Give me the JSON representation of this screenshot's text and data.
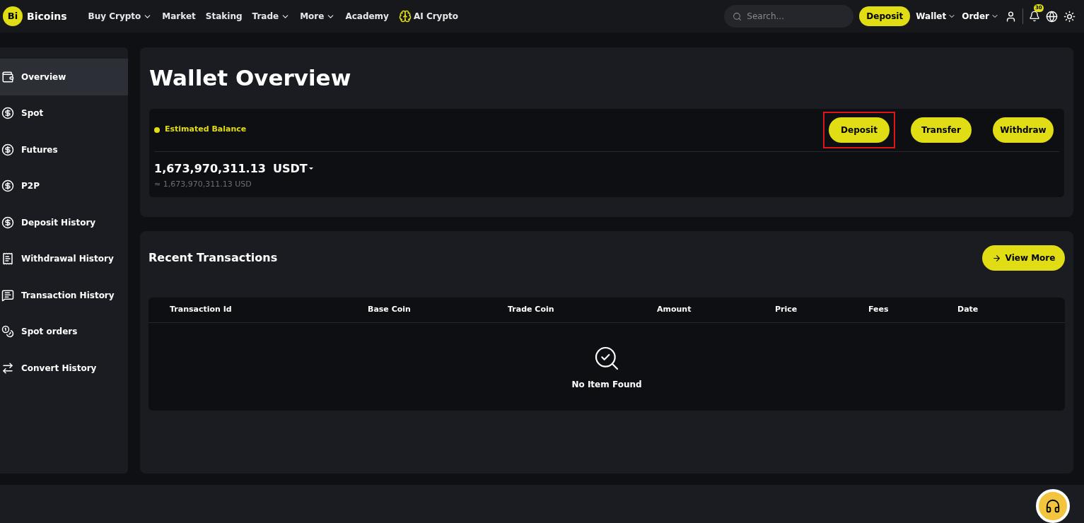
{
  "header": {
    "logo_mark": "Bi",
    "brand": "Bicoins",
    "nav": [
      {
        "label": "Buy Crypto",
        "dropdown": true
      },
      {
        "label": "Market",
        "dropdown": false
      },
      {
        "label": "Staking",
        "dropdown": false
      },
      {
        "label": "Trade",
        "dropdown": true
      },
      {
        "label": "More",
        "dropdown": true
      },
      {
        "label": "Academy",
        "dropdown": false
      },
      {
        "label": "AI Crypto",
        "dropdown": false,
        "kind": "ai"
      }
    ],
    "search": {
      "placeholder": "Search..."
    },
    "deposit": "Deposit",
    "menus": [
      {
        "label": "Wallet"
      },
      {
        "label": "Order"
      }
    ],
    "notification_count": "30"
  },
  "sidebar": {
    "items": [
      {
        "label": "Overview",
        "selected": true
      },
      {
        "label": "Spot",
        "selected": false
      },
      {
        "label": "Futures",
        "selected": false
      },
      {
        "label": "P2P",
        "selected": false
      },
      {
        "label": "Deposit History",
        "selected": false
      },
      {
        "label": "Withdrawal History",
        "selected": false
      },
      {
        "label": "Transaction History",
        "selected": false
      },
      {
        "label": "Spot orders",
        "selected": false
      },
      {
        "label": "Convert History",
        "selected": false
      }
    ]
  },
  "overview": {
    "title": "Wallet Overview",
    "balance_label": "Estimated Balance",
    "actions": [
      {
        "label": "Deposit",
        "highlighted": true
      },
      {
        "label": "Transfer",
        "highlighted": false
      },
      {
        "label": "Withdraw",
        "highlighted": false
      }
    ],
    "balance": "1,673,970,311.13",
    "currency": "USDT",
    "balance_usd": "≈ 1,673,970,311.13 USD"
  },
  "transactions": {
    "title": "Recent Transactions",
    "view_more": "View More",
    "columns": [
      "Transaction Id",
      "Base Coin",
      "Trade Coin",
      "Amount",
      "Price",
      "Fees",
      "Date"
    ],
    "empty": "No Item Found"
  }
}
